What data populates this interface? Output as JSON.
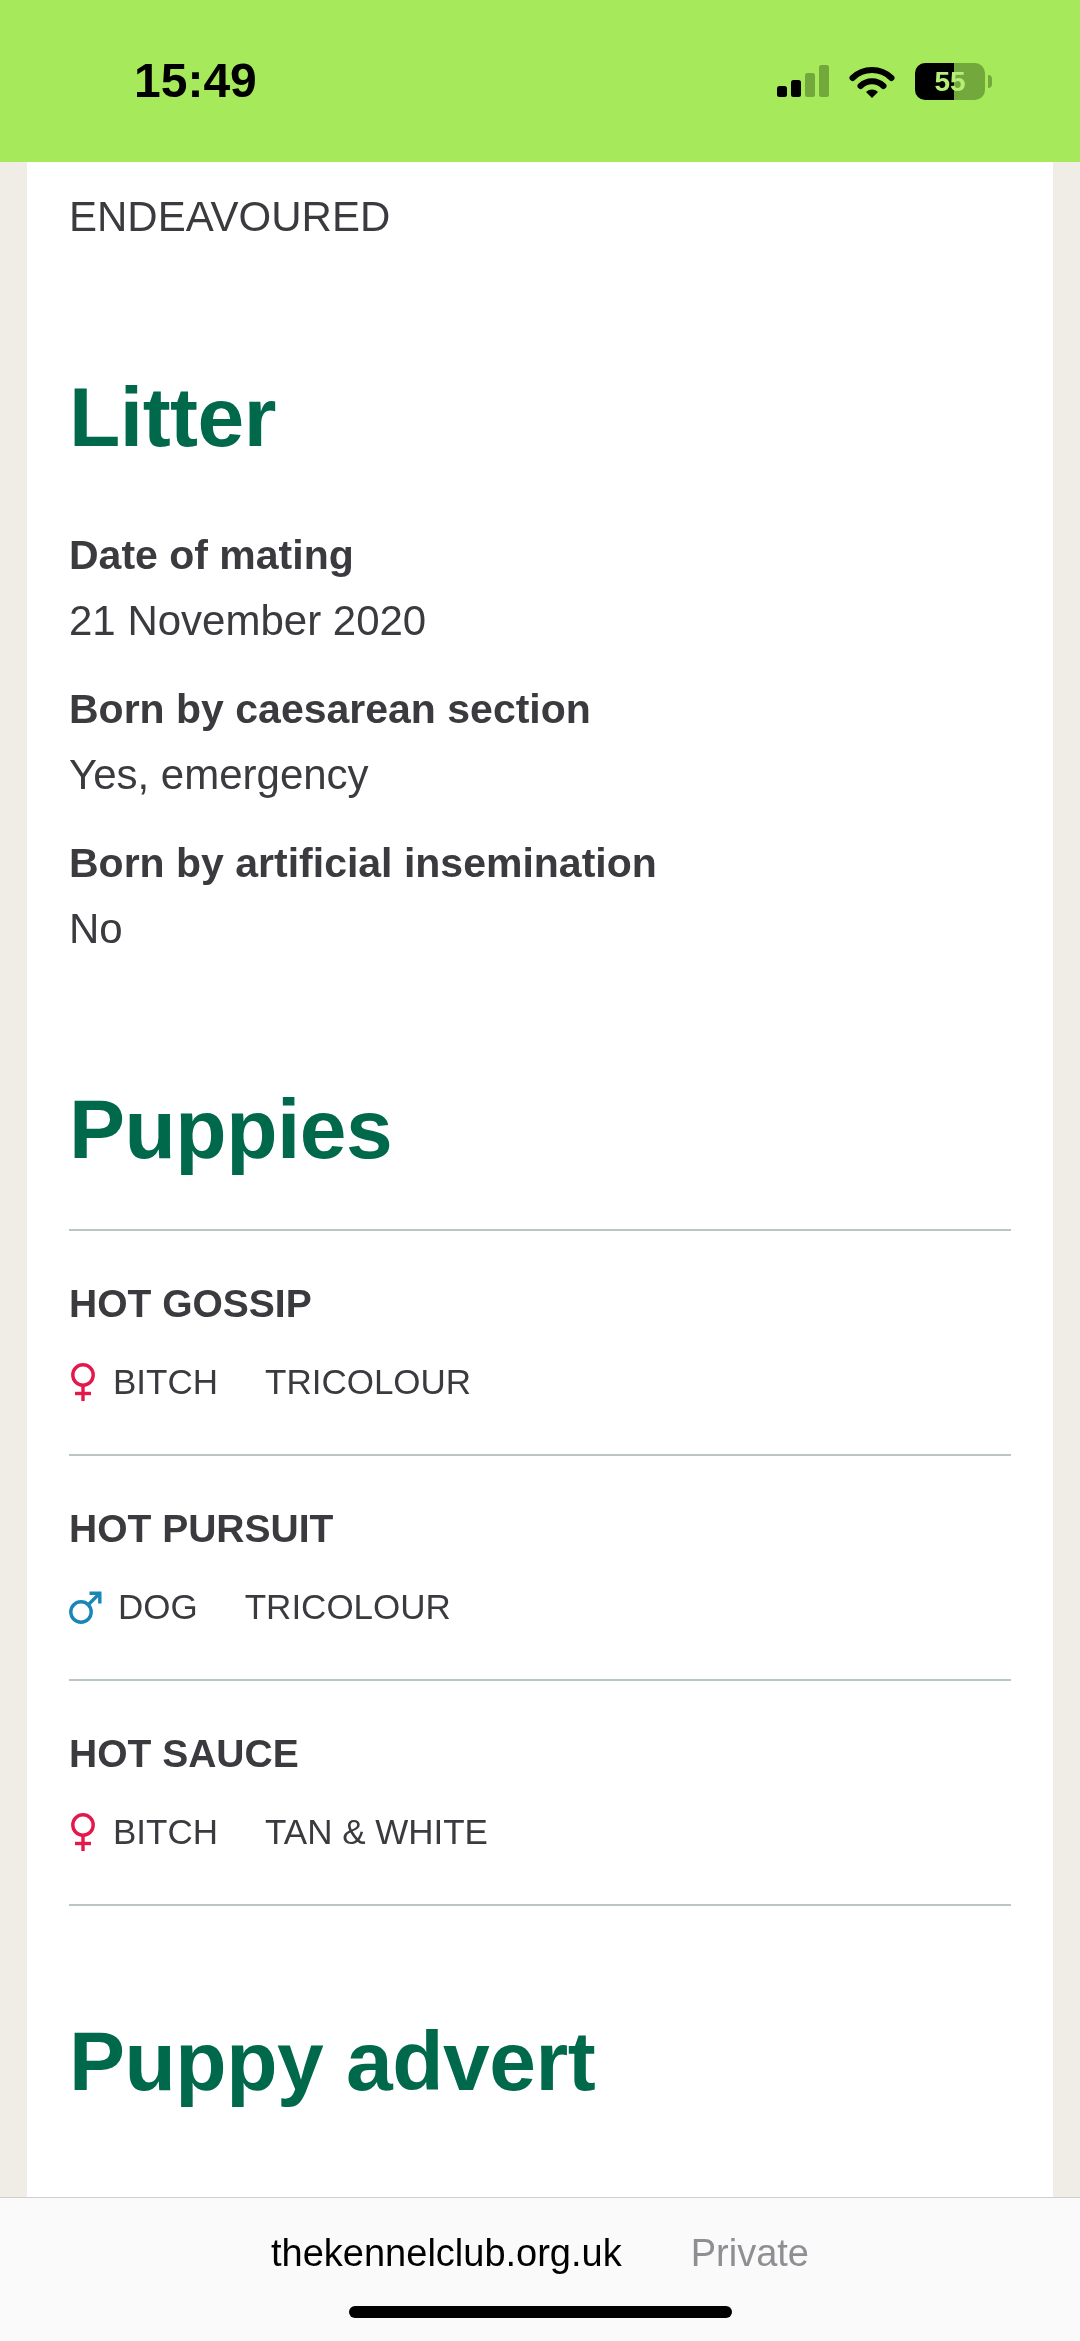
{
  "status_bar": {
    "time": "15:49",
    "battery": "55"
  },
  "top_field": {
    "value": "ENDEAVOURED"
  },
  "litter": {
    "heading": "Litter",
    "fields": [
      {
        "label": "Date of mating",
        "value": "21 November 2020"
      },
      {
        "label": "Born by caesarean section",
        "value": "Yes, emergency"
      },
      {
        "label": "Born by artificial insemination",
        "value": "No"
      }
    ]
  },
  "puppies": {
    "heading": "Puppies",
    "items": [
      {
        "name": "HOT GOSSIP",
        "kind": "female",
        "sex": "BITCH",
        "colour": "TRICOLOUR"
      },
      {
        "name": "HOT PURSUIT",
        "kind": "male",
        "sex": "DOG",
        "colour": "TRICOLOUR"
      },
      {
        "name": "HOT SAUCE",
        "kind": "female",
        "sex": "BITCH",
        "colour": "TAN & WHITE"
      }
    ]
  },
  "puppy_advert": {
    "heading": "Puppy advert"
  },
  "browser_bar": {
    "url": "thekennelclub.org.uk",
    "label": "Private"
  }
}
